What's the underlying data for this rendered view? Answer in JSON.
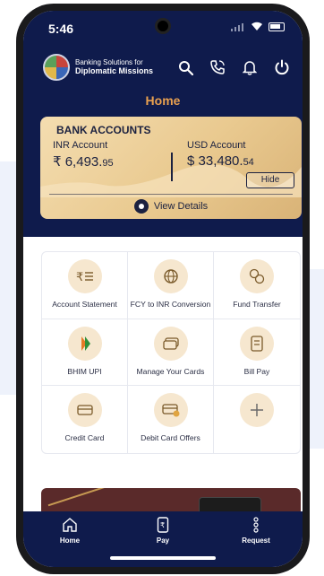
{
  "status_bar": {
    "time": "5:46"
  },
  "header": {
    "brand_line1": "Banking Solutions for",
    "brand_line2": "Diplomatic Missions",
    "title": "Home"
  },
  "accounts_card": {
    "title": "BANK ACCOUNTS",
    "inr": {
      "label": "INR Account",
      "amount": "₹ 6,493.",
      "decimals": "95"
    },
    "usd": {
      "label": "USD Account",
      "amount": "$ 33,480.",
      "decimals": "54"
    },
    "hide_label": "Hide",
    "view_details_label": "View Details"
  },
  "services": [
    {
      "label": "Account Statement",
      "icon": "rupee-statement-icon"
    },
    {
      "label": "FCY to INR Conversion",
      "icon": "currency-conversion-icon"
    },
    {
      "label": "Fund Transfer",
      "icon": "fund-transfer-icon"
    },
    {
      "label": "BHIM UPI",
      "icon": "bhim-upi-icon"
    },
    {
      "label": "Manage Your Cards",
      "icon": "cards-icon"
    },
    {
      "label": "Bill Pay",
      "icon": "bill-icon"
    },
    {
      "label": "Credit Card",
      "icon": "credit-card-icon"
    },
    {
      "label": "Debit Card Offers",
      "icon": "debit-card-offer-icon"
    },
    {
      "label": "",
      "icon": "plus-icon"
    }
  ],
  "bottom_nav": [
    {
      "label": "Home",
      "icon": "home-icon"
    },
    {
      "label": "Pay",
      "icon": "pay-icon"
    },
    {
      "label": "Request",
      "icon": "request-icon"
    }
  ],
  "colors": {
    "navy": "#0f1b4c",
    "title_orange": "#e8a04f",
    "card_gold": "#e9c98f",
    "icon_circle": "#f6e7cf"
  }
}
